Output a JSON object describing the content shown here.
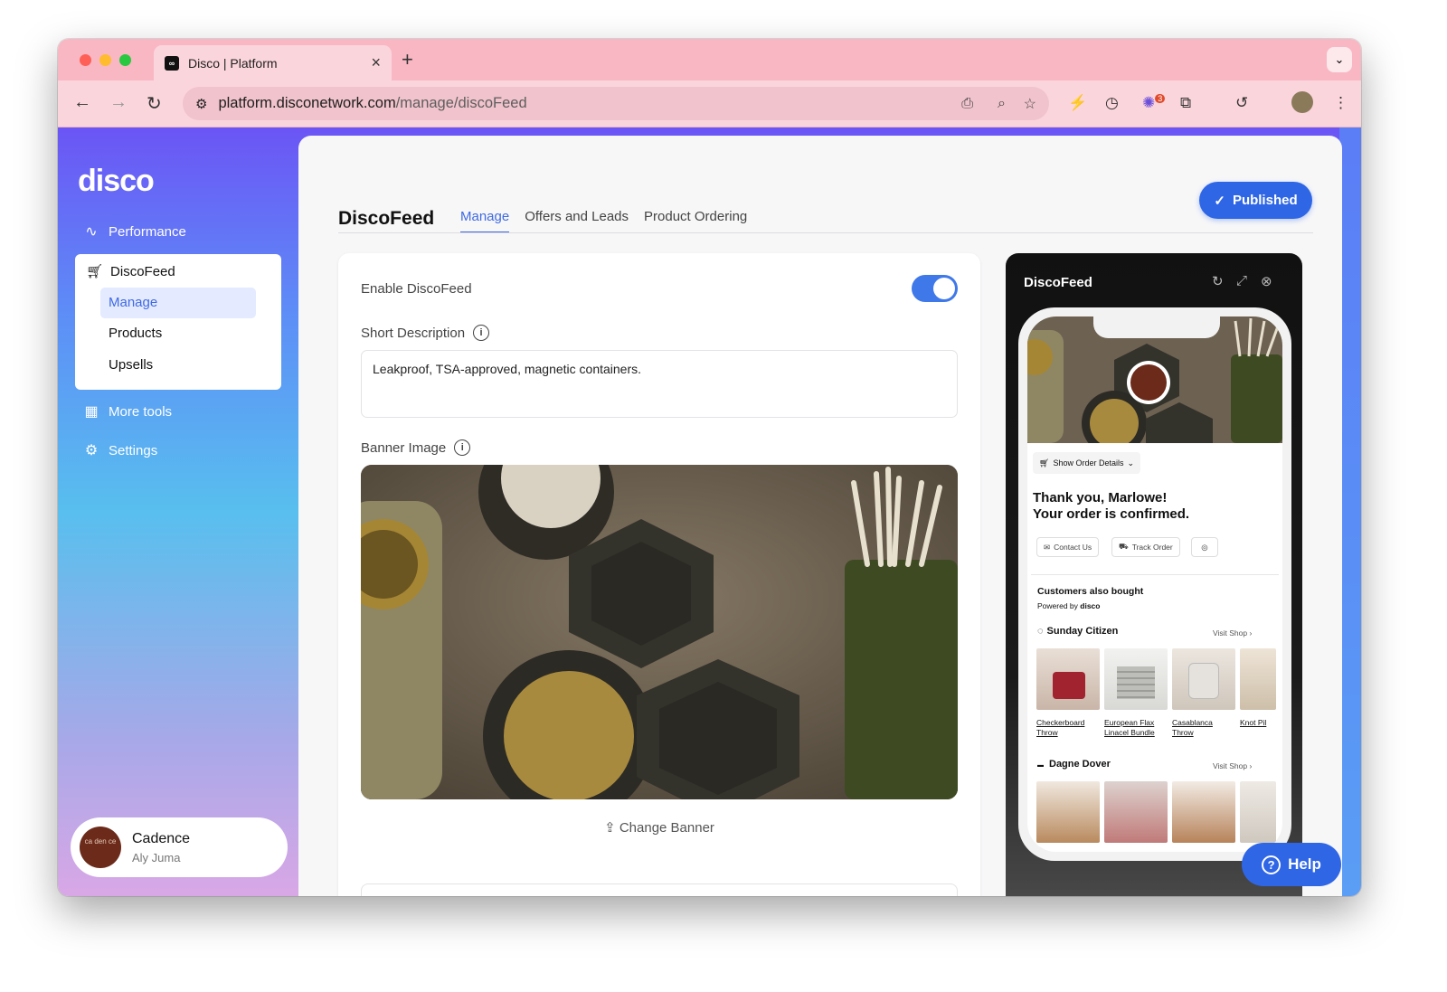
{
  "browser": {
    "tab_title": "Disco | Platform",
    "url_host": "platform.disconetwork.com",
    "url_path": "/manage/discoFeed",
    "extension_badge": "3"
  },
  "sidebar": {
    "logo": "disco",
    "performance": "Performance",
    "discofeed": "DiscoFeed",
    "subitems": [
      "Manage",
      "Products",
      "Upsells"
    ],
    "more_tools": "More tools",
    "settings": "Settings",
    "account": {
      "name": "Cadence",
      "user": "Aly Juma",
      "avatar_text": "ca den ce"
    }
  },
  "header": {
    "title": "DiscoFeed",
    "tabs": [
      "Manage",
      "Offers and Leads",
      "Product Ordering"
    ],
    "published": "Published"
  },
  "form": {
    "enable_label": "Enable DiscoFeed",
    "enabled": true,
    "short_desc_label": "Short Description",
    "short_desc_value": "Leakproof, TSA-approved, magnetic containers.",
    "banner_label": "Banner Image",
    "change_banner": "Change Banner"
  },
  "preview": {
    "title": "DiscoFeed",
    "order_details": "Show Order Details",
    "thank_you": "Thank you, Marlowe!",
    "confirmed": "Your order is confirmed.",
    "contact": "Contact Us",
    "track": "Track Order",
    "also_bought": "Customers also bought",
    "powered_by": "Powered by",
    "powered_brand": "disco",
    "visit_shop": "Visit Shop",
    "shop1": "Sunday Citizen",
    "shop1_products": [
      "Checkerboard Throw",
      "European Flax Linacel Bundle",
      "Casablanca Throw",
      "Knot Pil"
    ],
    "shop2": "Dagne Dover",
    "active_slide": 2,
    "slides": 5
  },
  "help": "Help"
}
